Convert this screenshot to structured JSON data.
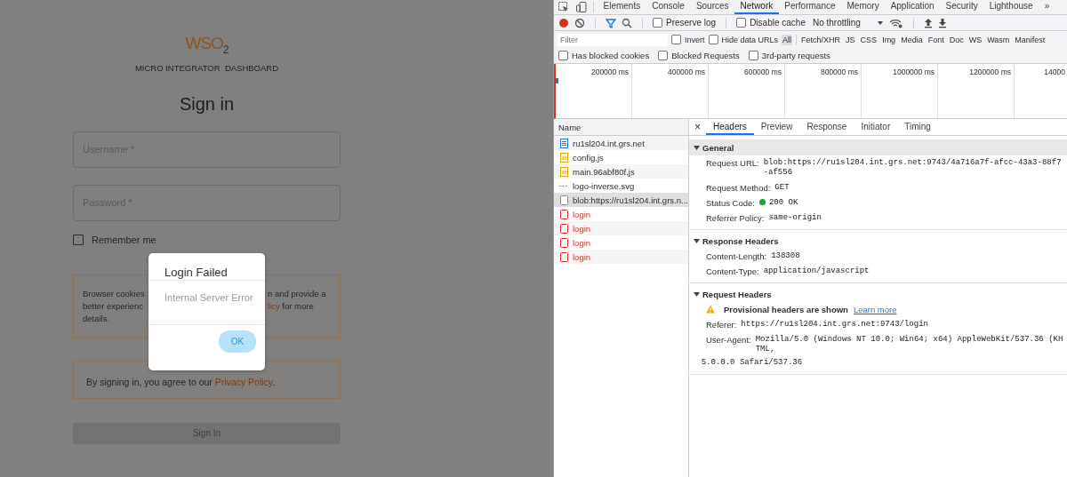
{
  "login": {
    "logo": "WSO$_{2}$",
    "subtitle": "MICRO INTEGRATOR  DASHBOARD",
    "heading": "Sign in",
    "fields": [
      {
        "placeholder": "Username *"
      },
      {
        "placeholder": "Password *"
      }
    ],
    "remember": {
      "label": "Remember me",
      "checked": false
    },
    "cookie_notice": {
      "left_lines": [
        "Browser cookies",
        "better experienc",
        "details."
      ],
      "right_lines": [
        [
          {
            "kind": "text",
            "text": "n and provide a"
          }
        ],
        [
          {
            "kind": "link",
            "text": "licy"
          },
          {
            "kind": "text",
            "text": " for more"
          }
        ]
      ]
    },
    "privacy": {
      "text": "By signing in, you agree to our ",
      "link": "Privacy Policy",
      "after": "."
    },
    "submit": {
      "label": "Sign In",
      "disabled": true
    },
    "dialog": {
      "title": "Login Failed",
      "message": "Internal Server Error",
      "button": "OK"
    }
  },
  "devtools": {
    "tabs": [
      {
        "label": "Elements",
        "selected": false
      },
      {
        "label": "Console",
        "selected": false
      },
      {
        "label": "Sources",
        "selected": false
      },
      {
        "label": "Network",
        "selected": true
      },
      {
        "label": "Performance",
        "selected": false
      },
      {
        "label": "Memory",
        "selected": false
      },
      {
        "label": "Application",
        "selected": false
      },
      {
        "label": "Security",
        "selected": false
      },
      {
        "label": "Lighthouse",
        "selected": false
      }
    ],
    "more": "»",
    "toolbar": {
      "recording": true,
      "checks": [
        {
          "label": "Preserve log",
          "checked": false
        },
        {
          "label": "Disable cache",
          "checked": false
        }
      ],
      "throttling": "No throttling"
    },
    "filter": {
      "placeholder": "Filter",
      "checks": [
        {
          "label": "Invert",
          "checked": false
        },
        {
          "label": "Hide data URLs",
          "checked": false
        }
      ],
      "types": [
        {
          "label": "All",
          "selected": true
        },
        {
          "label": "Fetch/XHR",
          "selected": false
        },
        {
          "label": "JS",
          "selected": false
        },
        {
          "label": "CSS",
          "selected": false
        },
        {
          "label": "Img",
          "selected": false
        },
        {
          "label": "Media",
          "selected": false
        },
        {
          "label": "Font",
          "selected": false
        },
        {
          "label": "Doc",
          "selected": false
        },
        {
          "label": "WS",
          "selected": false
        },
        {
          "label": "Wasm",
          "selected": false
        },
        {
          "label": "Manifest",
          "selected": false
        }
      ]
    },
    "options": [
      {
        "label": "Has blocked cookies",
        "checked": false
      },
      {
        "label": "Blocked Requests",
        "checked": false
      },
      {
        "label": "3rd-party requests",
        "checked": false
      }
    ],
    "timeline": {
      "ticks": [
        "200000 ms",
        "400000 ms",
        "600000 ms",
        "800000 ms",
        "1000000 ms",
        "1200000 ms",
        "14000"
      ]
    },
    "requests": {
      "header": "Name",
      "rows": [
        {
          "name": "ru1sl204.int.grs.net",
          "kind": "document",
          "failed": false,
          "selected": false
        },
        {
          "name": "config.js",
          "kind": "script",
          "failed": false,
          "selected": false
        },
        {
          "name": "main.96abf80f.js",
          "kind": "script",
          "failed": false,
          "selected": false
        },
        {
          "name": "logo-inverse.svg",
          "kind": "image",
          "failed": false,
          "selected": false
        },
        {
          "name": "blob:https://ru1sl204.int.grs.n...",
          "kind": "other",
          "failed": false,
          "selected": true
        },
        {
          "name": "login",
          "kind": "other",
          "failed": true,
          "selected": false
        },
        {
          "name": "login",
          "kind": "other",
          "failed": true,
          "selected": false
        },
        {
          "name": "login",
          "kind": "other",
          "failed": true,
          "selected": false
        },
        {
          "name": "login",
          "kind": "other",
          "failed": true,
          "selected": false
        }
      ]
    },
    "details": {
      "close": "×",
      "tabs": [
        {
          "label": "Headers",
          "selected": true
        },
        {
          "label": "Preview",
          "selected": false
        },
        {
          "label": "Response",
          "selected": false
        },
        {
          "label": "Initiator",
          "selected": false
        },
        {
          "label": "Timing",
          "selected": false
        }
      ],
      "sections": [
        {
          "title": "General",
          "expanded": true,
          "highlighted": true,
          "rows": [
            {
              "kind": "header",
              "label": "Request URL:",
              "value": "blob:https://ru1sl204.int.grs.net:9743/4a716a7f-afcc-43a3-88f7-af556"
            },
            {
              "kind": "header",
              "label": "Request Method:",
              "value": "GET"
            },
            {
              "kind": "status",
              "label": "Status Code:",
              "value": "200 OK"
            },
            {
              "kind": "header",
              "label": "Referrer Policy:",
              "value": "same-origin"
            }
          ]
        },
        {
          "title": "Response Headers",
          "expanded": true,
          "highlighted": false,
          "rows": [
            {
              "kind": "header",
              "label": "Content-Length:",
              "value": "138308"
            },
            {
              "kind": "header",
              "label": "Content-Type:",
              "value": "application/javascript"
            }
          ]
        },
        {
          "title": "Request Headers",
          "expanded": true,
          "highlighted": false,
          "rows": [
            {
              "kind": "warning",
              "label": "Provisional headers are shown",
              "link": "Learn more"
            },
            {
              "kind": "header",
              "label": "Referer:",
              "value": "https://ru1sl204.int.grs.net:9743/login"
            },
            {
              "kind": "header",
              "label": "User-Agent:",
              "value": "Mozilla/5.0 (Windows NT 10.0; Win64; x64) AppleWebKit/537.36 (KHTML,",
              "value_continued": "5.0.0.0 Safari/537.36"
            }
          ]
        }
      ]
    }
  }
}
